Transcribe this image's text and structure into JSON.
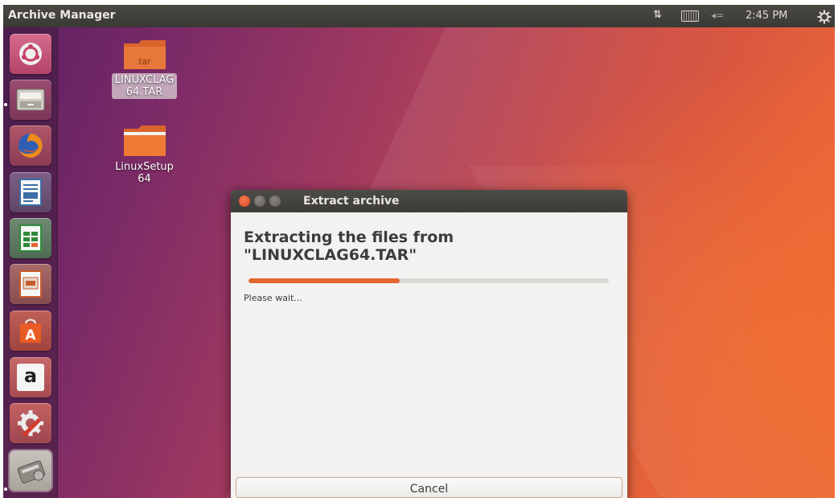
{
  "top_panel": {
    "app_title": "Archive Manager",
    "network_indicator": "⇅",
    "volume_indicator": "◂=",
    "clock": "2:45 PM",
    "icons": [
      "network-icon",
      "keyboard-icon",
      "volume-icon",
      "power-gear-icon"
    ]
  },
  "launcher": {
    "items": [
      {
        "name": "ubuntu-dash-icon"
      },
      {
        "name": "files-icon"
      },
      {
        "name": "firefox-icon"
      },
      {
        "name": "writer-icon"
      },
      {
        "name": "calc-icon"
      },
      {
        "name": "impress-icon"
      },
      {
        "name": "software-center-icon"
      },
      {
        "name": "amazon-icon",
        "glyph": "a"
      },
      {
        "name": "system-settings-icon"
      },
      {
        "name": "archive-manager-icon"
      }
    ]
  },
  "desktop": {
    "icons": [
      {
        "name": "linuxclag64-tar",
        "badge": "tar",
        "label_line1": "LINUXCLAG",
        "label_line2": "64.TAR",
        "selected": true
      },
      {
        "name": "linuxsetup64-folder",
        "label_line1": "LinuxSetup",
        "label_line2": "64",
        "selected": false
      }
    ]
  },
  "dialog": {
    "title": "Extract archive",
    "heading_line1": "Extracting the files from",
    "heading_line2": "\"LINUXCLAG64.TAR\"",
    "progress": 0.42,
    "status": "Please wait...",
    "cancel_label": "Cancel"
  },
  "colors": {
    "accent": "#e0662e",
    "close_button": "#e1552e",
    "panel_bg": "#3c3b37"
  }
}
